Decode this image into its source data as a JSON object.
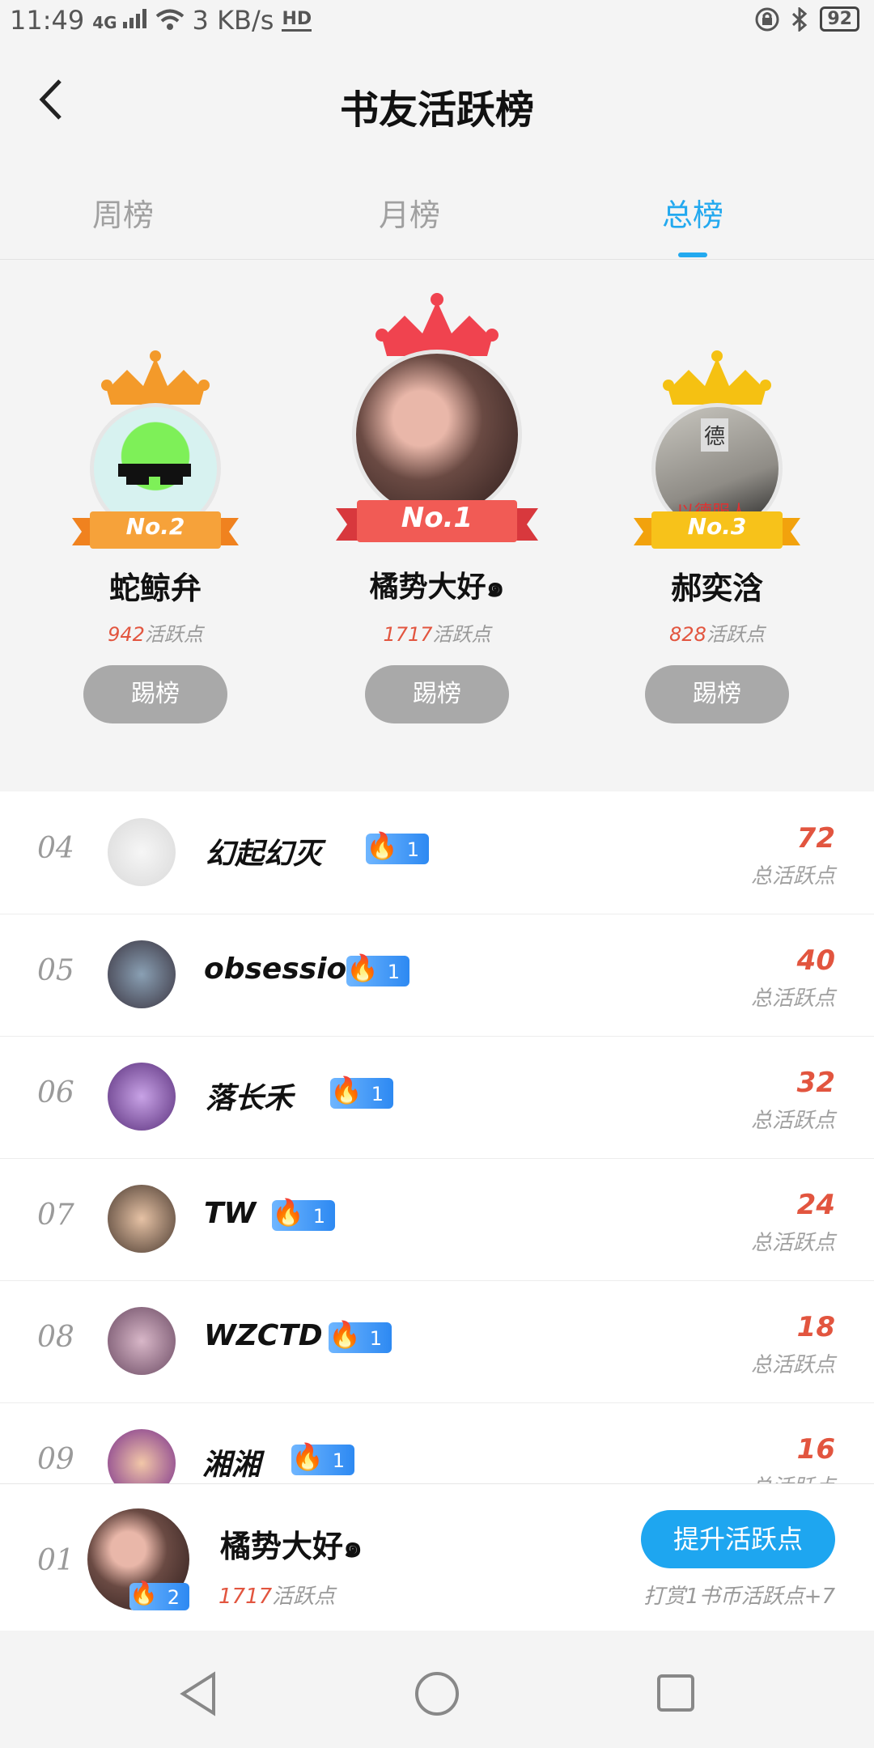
{
  "status": {
    "time": "11:49",
    "net_type": "4G",
    "speed": "3 KB/s",
    "hd": "HD",
    "battery": "92"
  },
  "header": {
    "title": "书友活跃榜"
  },
  "tabs": [
    {
      "label": "周榜"
    },
    {
      "label": "月榜"
    },
    {
      "label": "总榜",
      "active": true
    }
  ],
  "podium": {
    "second": {
      "rank_badge": "No.2",
      "name": "蛇鲸弁",
      "points": "942",
      "points_unit": "活跃点",
      "button": "踢榜"
    },
    "first": {
      "rank_badge": "No.1",
      "name": "橘势大好๑",
      "points": "1717",
      "points_unit": "活跃点",
      "button": "踢榜"
    },
    "third": {
      "rank_badge": "No.3",
      "name": "郝奕浛",
      "points": "828",
      "points_unit": "活跃点",
      "button": "踢榜",
      "avatar_text_top": "德",
      "avatar_text_bottom": "以德服人"
    }
  },
  "list": [
    {
      "rank": "04",
      "name": "幻起幻灭",
      "badge": "1",
      "score": "72",
      "label": "总活跃点"
    },
    {
      "rank": "05",
      "name": "obsession",
      "badge": "1",
      "score": "40",
      "label": "总活跃点"
    },
    {
      "rank": "06",
      "name": "落长禾",
      "badge": "1",
      "score": "32",
      "label": "总活跃点"
    },
    {
      "rank": "07",
      "name": "TW",
      "badge": "1",
      "score": "24",
      "label": "总活跃点"
    },
    {
      "rank": "08",
      "name": "WZCTD",
      "badge": "1",
      "score": "18",
      "label": "总活跃点"
    },
    {
      "rank": "09",
      "name": "湘湘",
      "badge": "1",
      "score": "16",
      "label": "总活跃点"
    }
  ],
  "me": {
    "rank": "01",
    "name": "橘势大好๑",
    "badge": "2",
    "points": "1717",
    "points_unit": "活跃点",
    "boost_button": "提升活跃点",
    "reward_note": "打赏1书币活跃点+7"
  },
  "colors": {
    "accent": "#23a9ef",
    "score": "#e2553f",
    "kick_button": "#a9a9a9"
  }
}
